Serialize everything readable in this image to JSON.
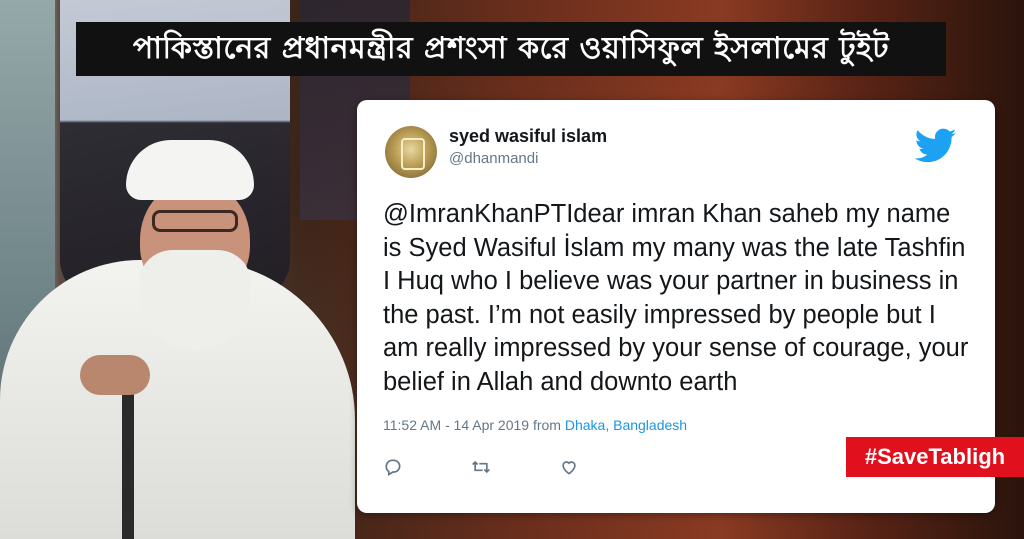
{
  "headline": {
    "text": "পাকিস্তানের প্রধানমন্ত্রীর প্রশংসা করে ওয়াসিফুল ইসলামের টুইট"
  },
  "tweet": {
    "author_name": "syed wasiful islam",
    "author_handle": "@dhanmandi",
    "avatar_icon": "avatar-image",
    "brand_icon": "twitter-bird-icon",
    "brand_color": "#1da1f2",
    "text": "@ImranKhanPTIdear imran Khan saheb my name is Syed Wasiful İslam my many was the late Tashfin I Huq who I believe was your partner in business in the past. I’m not easily impressed by people but I am really impressed by your sense of courage, your belief in Allah and downto earth",
    "timestamp": "11:52 AM - 14 Apr 2019",
    "from_label": "from",
    "location": "Dhaka, Bangladesh",
    "actions": [
      {
        "icon": "reply-icon"
      },
      {
        "icon": "retweet-icon"
      },
      {
        "icon": "like-icon"
      }
    ]
  },
  "badge": {
    "text": "#SaveTabligh",
    "color": "#e0101c"
  }
}
